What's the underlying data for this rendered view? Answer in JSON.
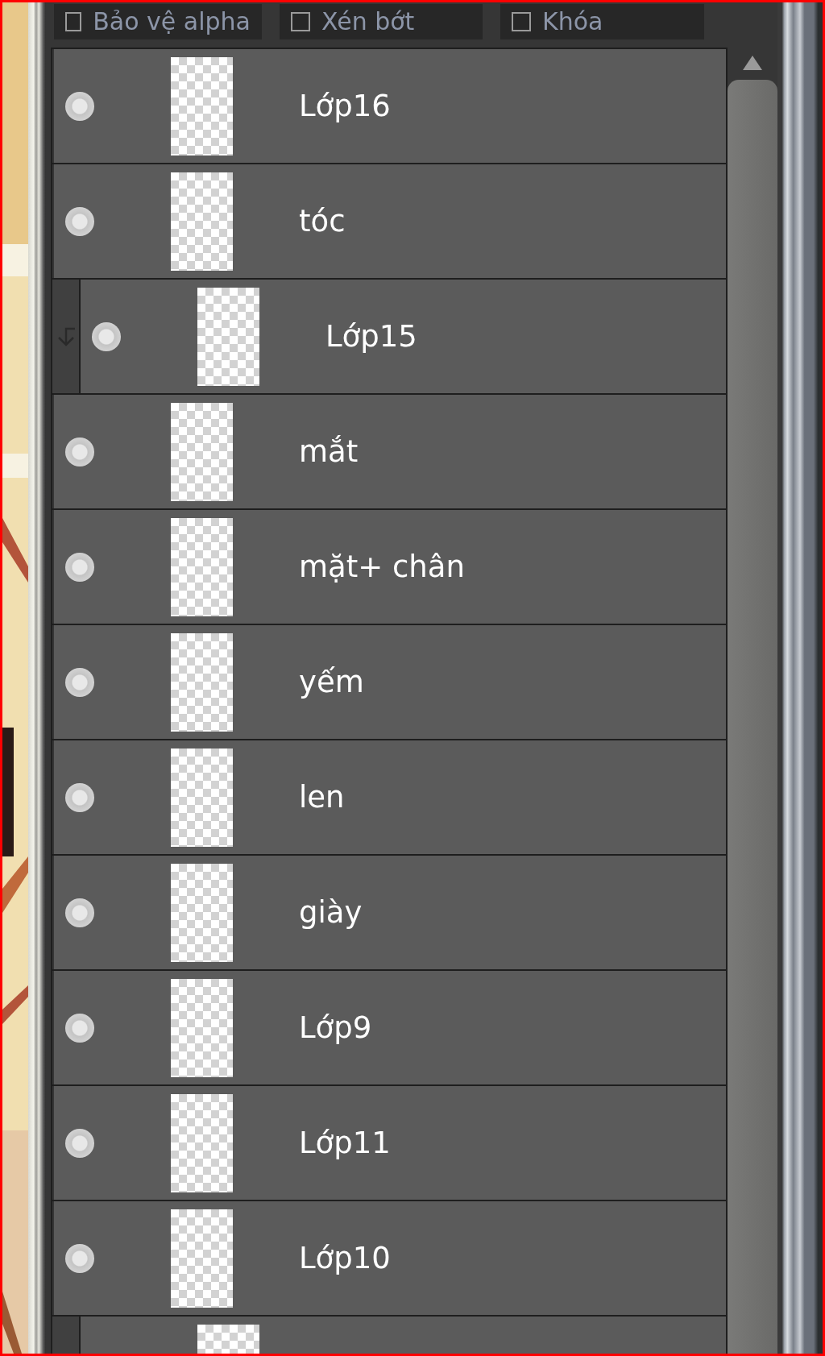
{
  "options": [
    {
      "label": "Bảo vệ alpha",
      "checked": false
    },
    {
      "label": "Xén bớt",
      "checked": false
    },
    {
      "label": "Khóa",
      "checked": false
    }
  ],
  "layers": [
    {
      "name": "Lớp16",
      "kind": "normal"
    },
    {
      "name": "tóc",
      "kind": "normal"
    },
    {
      "name": "Lớp15",
      "kind": "clipped"
    },
    {
      "name": "mắt",
      "kind": "normal"
    },
    {
      "name": "mặt+ chân",
      "kind": "normal"
    },
    {
      "name": "yếm",
      "kind": "normal"
    },
    {
      "name": "len",
      "kind": "normal"
    },
    {
      "name": "giày",
      "kind": "normal"
    },
    {
      "name": "Lớp9",
      "kind": "normal"
    },
    {
      "name": "Lớp11",
      "kind": "normal"
    },
    {
      "name": "Lớp10",
      "kind": "normal"
    },
    {
      "kind": "clipped"
    }
  ]
}
